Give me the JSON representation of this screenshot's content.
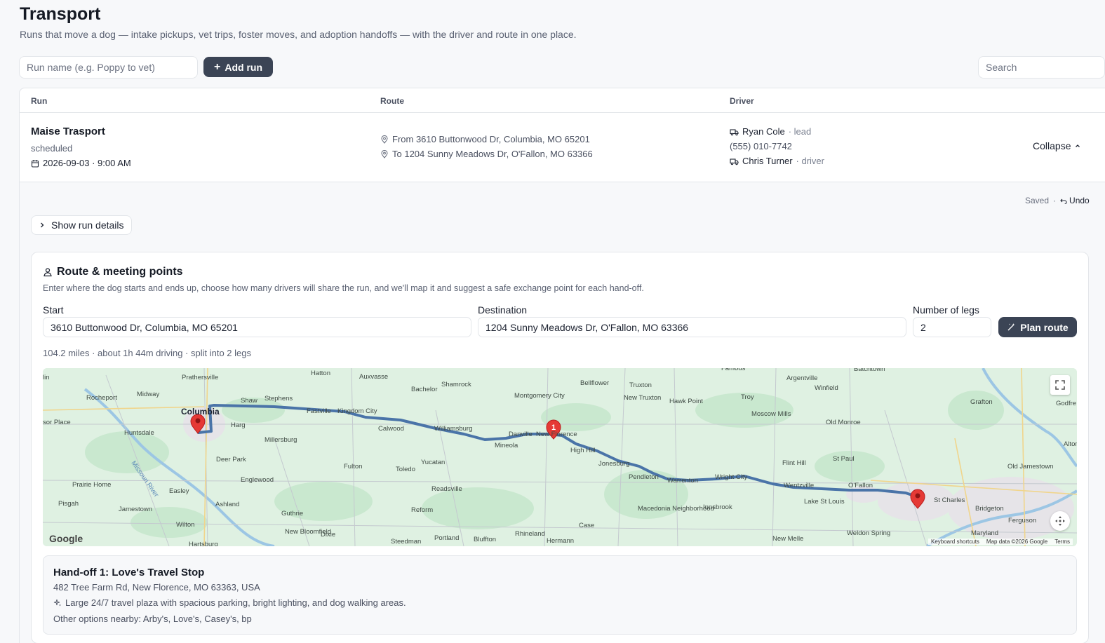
{
  "header": {
    "title": "Transport",
    "subtitle": "Runs that move a dog — intake pickups, vet trips, foster moves, and adoption handoffs — with the driver and route in one place."
  },
  "toolbar": {
    "run_name_placeholder": "Run name (e.g. Poppy to vet)",
    "add_run_label": "Add run",
    "search_placeholder": "Search"
  },
  "table": {
    "columns": [
      "Run",
      "Route",
      "Driver"
    ],
    "run": {
      "name": "Maise Trasport",
      "status": "scheduled",
      "datetime": "2026-09-03 · 9:00 AM",
      "route_from": "From 3610 Buttonwood Dr, Columbia, MO 65201",
      "route_to": "To 1204 Sunny Meadows Dr, O'Fallon, MO 63366",
      "drivers": [
        {
          "name": "Ryan Cole",
          "role": "· lead",
          "phone": "(555) 010-7742"
        },
        {
          "name": "Chris Turner",
          "role": "· driver"
        }
      ],
      "collapse_label": "Collapse"
    }
  },
  "detail": {
    "saved_label": "Saved",
    "separator": "·",
    "undo_label": "Undo",
    "show_details_label": "Show run details"
  },
  "route_card": {
    "title": "Route & meeting points",
    "description": "Enter where the dog starts and ends up, choose how many drivers will share the run, and we'll map it and suggest a safe exchange point for each hand-off.",
    "start_label": "Start",
    "start_value": "3610 Buttonwood Dr, Columbia, MO 65201",
    "destination_label": "Destination",
    "destination_value": "1204 Sunny Meadows Dr, O'Fallon, MO 63366",
    "legs_label": "Number of legs",
    "legs_value": "2",
    "plan_button_label": "Plan route",
    "summary": "104.2 miles · about 1h 44m driving · split into 2 legs"
  },
  "map": {
    "logo": "Google",
    "keyboard_shortcuts": "Keyboard shortcuts",
    "map_data": "Map data ©2026 Google",
    "terms": "Terms",
    "handoff_marker": "1",
    "places": [
      {
        "name": "Columbia"
      },
      {
        "name": "Rocheport"
      },
      {
        "name": "Midway"
      },
      {
        "name": "Prathersville"
      },
      {
        "name": "Hatton"
      },
      {
        "name": "Auxvasse"
      },
      {
        "name": "Bachelor"
      },
      {
        "name": "Shamrock"
      },
      {
        "name": "Montgomery City"
      },
      {
        "name": "Bellflower"
      },
      {
        "name": "Truxton"
      },
      {
        "name": "New Truxton"
      },
      {
        "name": "Hawk Point"
      },
      {
        "name": "Troy"
      },
      {
        "name": "Argentville"
      },
      {
        "name": "Winfield"
      },
      {
        "name": "Moscow Mills"
      },
      {
        "name": "Old Monroe"
      },
      {
        "name": "Grafton"
      },
      {
        "name": "Shaw"
      },
      {
        "name": "Stephens"
      },
      {
        "name": "Harg"
      },
      {
        "name": "Fastville"
      },
      {
        "name": "Kingdom City"
      },
      {
        "name": "Calwood"
      },
      {
        "name": "Williamsburg"
      },
      {
        "name": "Danville"
      },
      {
        "name": "New Florence"
      },
      {
        "name": "Mineola"
      },
      {
        "name": "High Hill"
      },
      {
        "name": "Jonesburg"
      },
      {
        "name": "Huntsdale"
      },
      {
        "name": "Millersburg"
      },
      {
        "name": "Deer Park"
      },
      {
        "name": "Englewood"
      },
      {
        "name": "Fulton"
      },
      {
        "name": "Toledo"
      },
      {
        "name": "Yucatan"
      },
      {
        "name": "Readsville"
      },
      {
        "name": "Reform"
      },
      {
        "name": "Pendleton"
      },
      {
        "name": "Warrenton"
      },
      {
        "name": "Wright City"
      },
      {
        "name": "Flint Hill"
      },
      {
        "name": "St Paul"
      },
      {
        "name": "Wentzville"
      },
      {
        "name": "O'Fallon"
      },
      {
        "name": "Lake St Louis"
      },
      {
        "name": "St Charles"
      },
      {
        "name": "Bridgeton"
      },
      {
        "name": "Old Jamestown"
      },
      {
        "name": "Prairie Home"
      },
      {
        "name": "Pisgah"
      },
      {
        "name": "Jamestown"
      },
      {
        "name": "Easley"
      },
      {
        "name": "Ashland"
      },
      {
        "name": "Wilton"
      },
      {
        "name": "Guthrie"
      },
      {
        "name": "New Bloomfield"
      },
      {
        "name": "Dixie"
      },
      {
        "name": "Steedman"
      },
      {
        "name": "Portland"
      },
      {
        "name": "Bluffton"
      },
      {
        "name": "Rhineland"
      },
      {
        "name": "Case"
      },
      {
        "name": "Hermann"
      },
      {
        "name": "Macedonia Neighborhood"
      },
      {
        "name": "Innsbrook"
      },
      {
        "name": "Weldon Spring"
      },
      {
        "name": "New Melle"
      },
      {
        "name": "Maryland"
      },
      {
        "name": "Ferguson"
      },
      {
        "name": "Missouri River"
      },
      {
        "name": "Godfre"
      },
      {
        "name": "Alton"
      },
      {
        "name": "Famous"
      },
      {
        "name": "Batchtown"
      },
      {
        "name": "sor Place"
      },
      {
        "name": "Hartsburg"
      },
      {
        "name": "lin"
      }
    ]
  },
  "handoff": {
    "title": "Hand-off 1: Love's Travel Stop",
    "address": "482 Tree Farm Rd, New Florence, MO 63363, USA",
    "note": "Large 24/7 travel plaza with spacious parking, bright lighting, and dog walking areas.",
    "others": "Other options nearby: Arby's, Love's, Casey's, bp"
  },
  "colors": {
    "primary_button": "#3b4455",
    "route_line": "#4a74a8",
    "marker": "#e53935",
    "map_land": "#dff1e2"
  }
}
